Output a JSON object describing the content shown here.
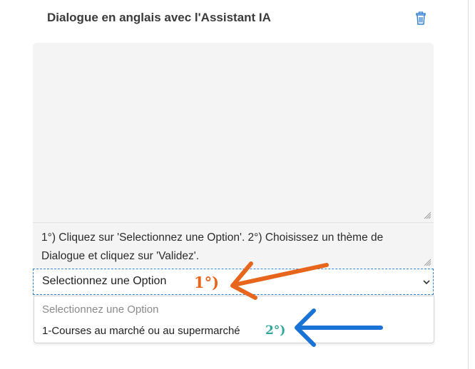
{
  "header": {
    "title": "Dialogue en anglais avec l'Assistant IA",
    "delete_icon": "trash-icon"
  },
  "instruction": {
    "text": "1°) Cliquez sur 'Selectionnez une Option'. 2°) Choisissez un thème de Dialogue et cliquez sur 'Validez'."
  },
  "select": {
    "selected_value": "Selectionnez une Option",
    "icon": "chevron-down-icon",
    "options": [
      "Selectionnez une Option",
      "1-Courses au marché ou au supermarché"
    ]
  },
  "annotations": {
    "step1": "1°)",
    "step2": "2°)",
    "step1_color": "#e8661c",
    "step2_color": "#2ea69a",
    "arrow2_color": "#1a73d6"
  },
  "colors": {
    "accent": "#2f7fd1",
    "panel_bg": "#f4f4f4"
  }
}
